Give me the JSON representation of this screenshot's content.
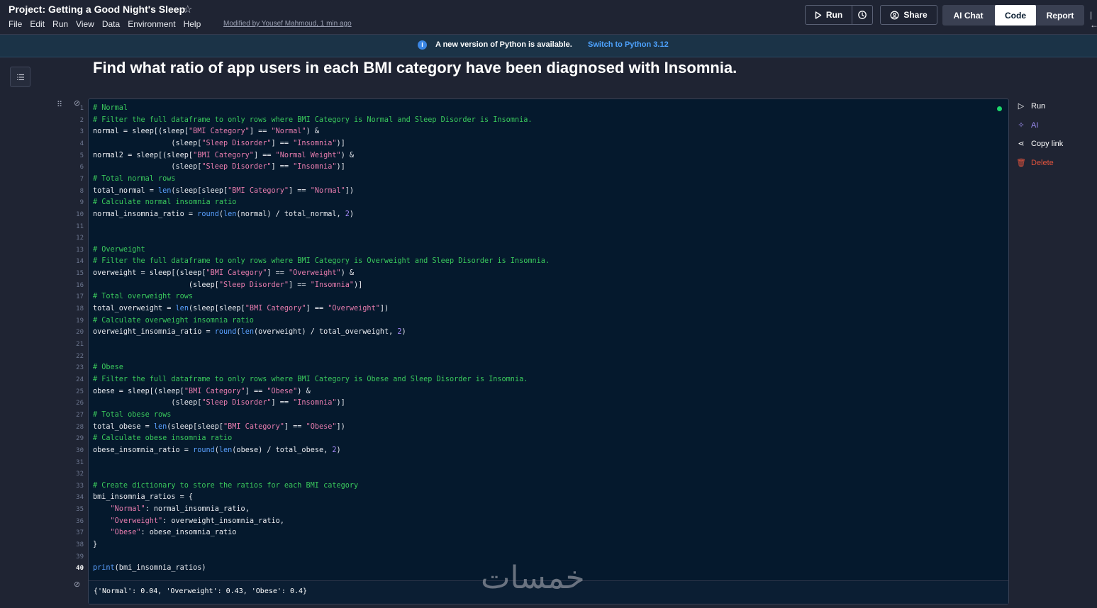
{
  "app": {
    "project_title": "Project: Getting a Good Night's Sleep",
    "menu": [
      "File",
      "Edit",
      "Run",
      "View",
      "Data",
      "Environment",
      "Help"
    ],
    "modified": "Modified by Yousef Mahmoud, 1 min ago"
  },
  "toolbar": {
    "run_label": "Run",
    "share_label": "Share",
    "ai_chat_label": "AI Chat",
    "code_label": "Code",
    "report_label": "Report",
    "active_view": "Code"
  },
  "banner": {
    "message": "A new version of Python is available.",
    "link": "Switch to Python 3.12"
  },
  "notebook": {
    "heading": "Find what ratio of app users in each BMI category have been diagnosed with Insomnia.",
    "current_line": 40,
    "line_numbers": [
      1,
      2,
      3,
      4,
      5,
      6,
      7,
      8,
      9,
      10,
      11,
      12,
      13,
      14,
      15,
      16,
      17,
      18,
      19,
      20,
      21,
      22,
      23,
      24,
      25,
      26,
      27,
      28,
      29,
      30,
      31,
      32,
      33,
      34,
      35,
      36,
      37,
      38,
      39,
      40
    ],
    "code_lines": [
      "# Normal",
      "# Filter the full dataframe to only rows where BMI Category is Normal and Sleep Disorder is Insomnia.",
      "normal = sleep[(sleep[\"BMI Category\"] == \"Normal\") &",
      "                  (sleep[\"Sleep Disorder\"] == \"Insomnia\")]",
      "normal2 = sleep[(sleep[\"BMI Category\"] == \"Normal Weight\") &",
      "                  (sleep[\"Sleep Disorder\"] == \"Insomnia\")]",
      "# Total normal rows",
      "total_normal = len(sleep[sleep[\"BMI Category\"] == \"Normal\"])",
      "# Calculate normal insomnia ratio",
      "normal_insomnia_ratio = round(len(normal) / total_normal, 2)",
      "",
      "",
      "# Overweight",
      "# Filter the full dataframe to only rows where BMI Category is Overweight and Sleep Disorder is Insomnia.",
      "overweight = sleep[(sleep[\"BMI Category\"] == \"Overweight\") &",
      "                      (sleep[\"Sleep Disorder\"] == \"Insomnia\")]",
      "# Total overweight rows",
      "total_overweight = len(sleep[sleep[\"BMI Category\"] == \"Overweight\"])",
      "# Calculate overweight insomnia ratio",
      "overweight_insomnia_ratio = round(len(overweight) / total_overweight, 2)",
      "",
      "",
      "# Obese",
      "# Filter the full dataframe to only rows where BMI Category is Obese and Sleep Disorder is Insomnia.",
      "obese = sleep[(sleep[\"BMI Category\"] == \"Obese\") &",
      "                  (sleep[\"Sleep Disorder\"] == \"Insomnia\")]",
      "# Total obese rows",
      "total_obese = len(sleep[sleep[\"BMI Category\"] == \"Obese\"])",
      "# Calculate obese insomnia ratio",
      "obese_insomnia_ratio = round(len(obese) / total_obese, 2)",
      "",
      "",
      "# Create dictionary to store the ratios for each BMI category",
      "bmi_insomnia_ratios = {",
      "    \"Normal\": normal_insomnia_ratio,",
      "    \"Overweight\": overweight_insomnia_ratio,",
      "    \"Obese\": obese_insomnia_ratio",
      "}",
      "",
      "print(bmi_insomnia_ratios)"
    ],
    "output": "{'Normal': 0.04, 'Overweight': 0.43, 'Obese': 0.4}"
  },
  "cell_actions": {
    "run": "Run",
    "ai": "AI",
    "copy_link": "Copy link",
    "delete": "Delete"
  },
  "watermark": "خمسات",
  "colors": {
    "background": "#1f2433",
    "cell_bg": "#05192d",
    "comment": "#3ac95c",
    "string": "#e77cae",
    "builtin": "#5aa0ff",
    "number": "#a78bfa",
    "link": "#4ea3ff",
    "delete": "#e0533d",
    "status_ok": "#1bd76a"
  }
}
